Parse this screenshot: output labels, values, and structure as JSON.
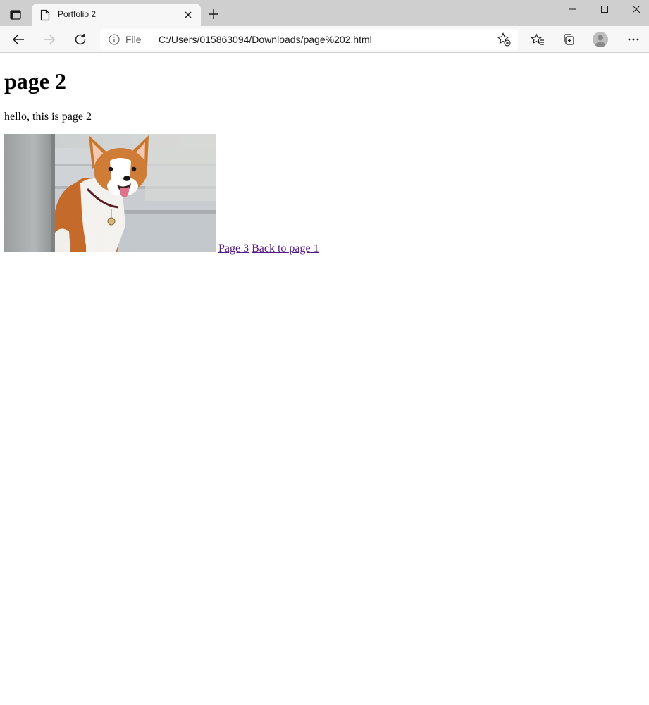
{
  "browser": {
    "tab": {
      "title": "Portfolio 2"
    },
    "address_bar": {
      "site_info_label": "File",
      "url": "C:/Users/015863094/Downloads/page%202.html"
    }
  },
  "page": {
    "heading": "page 2",
    "paragraph": "hello, this is page 2",
    "links": [
      {
        "label": "Page 3"
      },
      {
        "label": "Back to page 1"
      }
    ]
  },
  "colors": {
    "tabstrip_bg": "#cfcfcf",
    "toolbar_bg": "#f7f7f7",
    "visited_link": "#551a8b"
  }
}
